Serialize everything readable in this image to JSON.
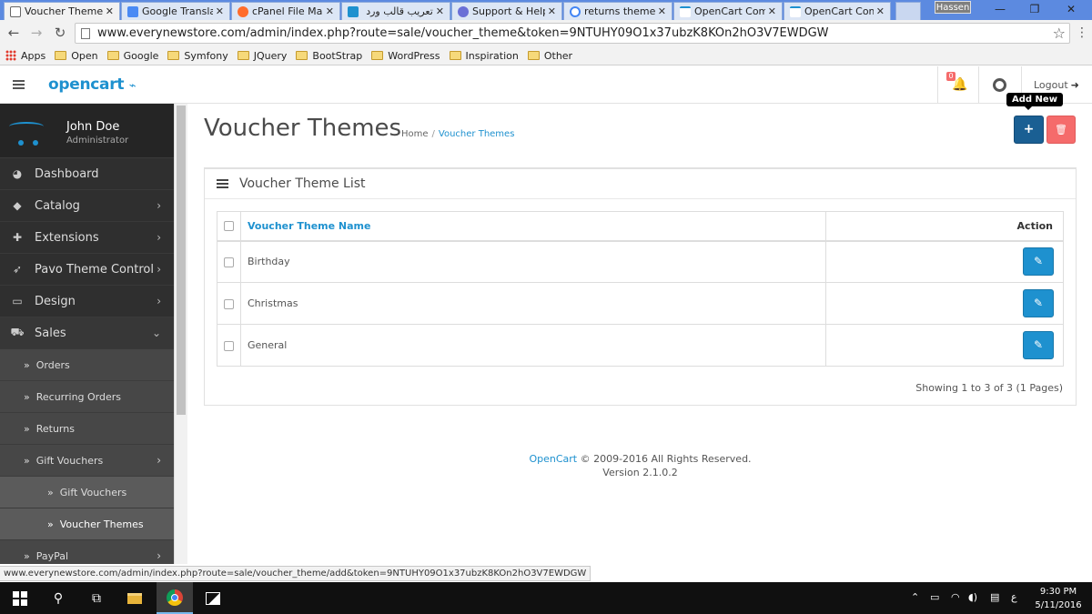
{
  "browser": {
    "tabs": [
      {
        "title": "Voucher Theme",
        "favicon": "page-icon",
        "active": true
      },
      {
        "title": "Google Translat",
        "favicon": "translate-icon"
      },
      {
        "title": "cPanel File Man",
        "favicon": "cpanel-icon"
      },
      {
        "title": "تعريب قالب ورد",
        "favicon": "blue-square-icon"
      },
      {
        "title": "Support & Help",
        "favicon": "support-icon"
      },
      {
        "title": "returns theme",
        "favicon": "google-icon"
      },
      {
        "title": "OpenCart Com",
        "favicon": "opencart-icon"
      },
      {
        "title": "OpenCart Com",
        "favicon": "opencart-icon"
      }
    ],
    "profile_name": "Hassen",
    "url": "www.everynewstore.com/admin/index.php?route=sale/voucher_theme&token=9NTUHY09O1x37ubzK8KOn2hO3V7EWDGW",
    "bookmarks": [
      "Apps",
      "Open",
      "Google",
      "Symfony",
      "JQuery",
      "BootStrap",
      "WordPress",
      "Inspiration",
      "Other"
    ],
    "status_url": "www.everynewstore.com/admin/index.php?route=sale/voucher_theme/add&token=9NTUHY09O1x37ubzK8KOn2hO3V7EWDGW"
  },
  "header": {
    "logo": "opencart",
    "notification_count": "0",
    "logout_label": "Logout"
  },
  "sidebar": {
    "user_name": "John Doe",
    "user_role": "Administrator",
    "items": [
      {
        "label": "Dashboard",
        "icon": "dashboard-icon"
      },
      {
        "label": "Catalog",
        "icon": "tag-icon"
      },
      {
        "label": "Extensions",
        "icon": "puzzle-icon"
      },
      {
        "label": "Pavo Theme Control",
        "icon": "rocket-icon"
      },
      {
        "label": "Design",
        "icon": "monitor-icon"
      },
      {
        "label": "Sales",
        "icon": "cart-icon"
      }
    ],
    "sales_sub": [
      "Orders",
      "Recurring Orders",
      "Returns",
      "Gift Vouchers"
    ],
    "gift_sub": [
      "Gift Vouchers",
      "Voucher Themes"
    ],
    "after": [
      "PayPal"
    ]
  },
  "main": {
    "title": "Voucher Themes",
    "breadcrumb_home": "Home",
    "breadcrumb_sep": "/",
    "breadcrumb_current": "Voucher Themes",
    "add_tooltip": "Add New",
    "panel_title": "Voucher Theme List",
    "columns": {
      "name": "Voucher Theme Name",
      "action": "Action"
    },
    "rows": [
      "Birthday",
      "Christmas",
      "General"
    ],
    "pagination_text": "Showing 1 to 3 of 3 (1 Pages)"
  },
  "footer": {
    "brand": "OpenCart",
    "copyright": "© 2009-2016 All Rights Reserved.",
    "version": "Version 2.1.0.2"
  },
  "taskbar": {
    "time": "9:30 PM",
    "date": "5/11/2016",
    "input_lang": "ع"
  },
  "colors": {
    "accent": "#1e91cf",
    "add_button": "#1a5f93",
    "delete_button": "#f56b6b",
    "sidebar_bg": "#2f2f2f"
  }
}
